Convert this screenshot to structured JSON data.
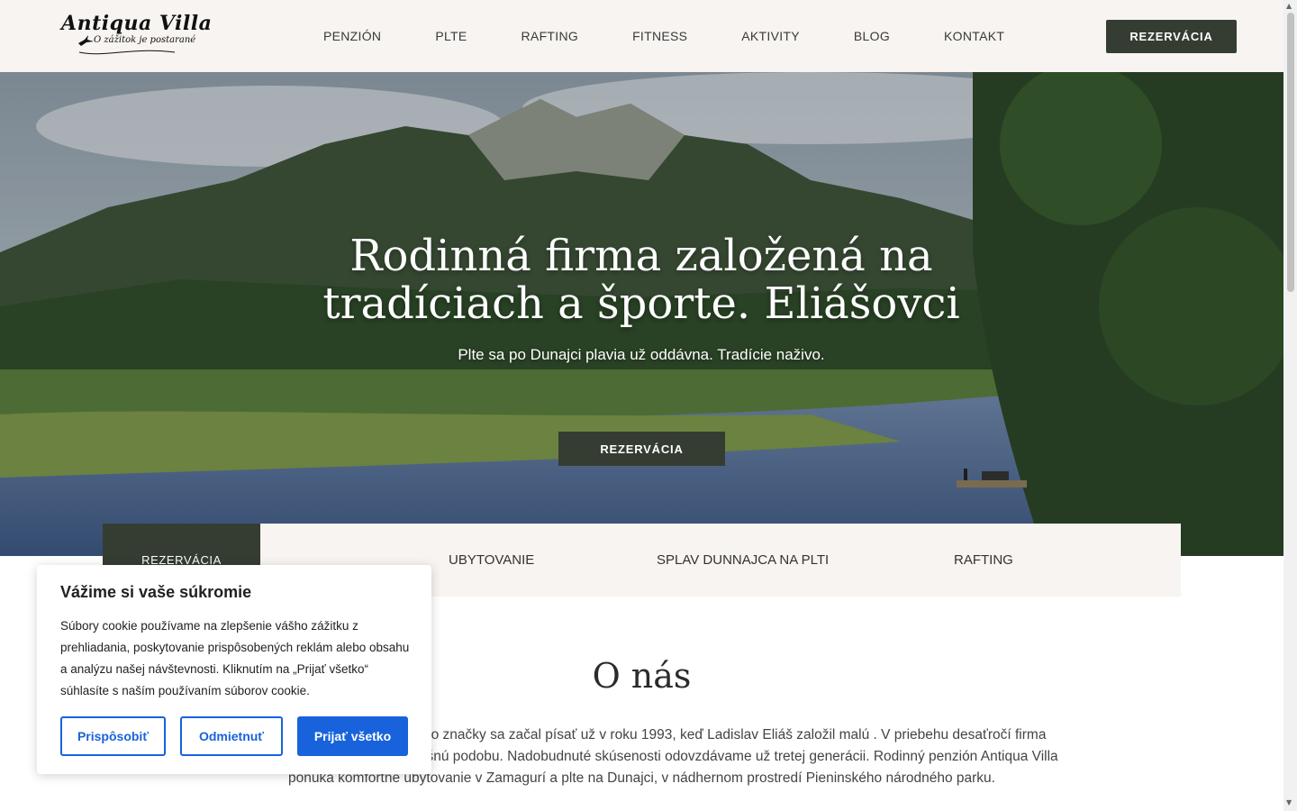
{
  "header": {
    "logo_title": "Antiqua Villa",
    "logo_tagline": "O zážitok je postarané",
    "nav": [
      "PENZIÓN",
      "PLTE",
      "RAFTING",
      "FITNESS",
      "AKTIVITY",
      "BLOG",
      "KONTAKT"
    ],
    "cta": "REZERVÁCIA"
  },
  "hero": {
    "title": "Rodinná firma založená na tradíciach a športe. Eliášovci",
    "subtitle": "Plte sa po Dunajci plavia už oddávna. Tradície naživo.",
    "cta": "REZERVÁCIA"
  },
  "tabs": {
    "active": "REZERVÁCIA",
    "items": [
      "UBYTOVANIE",
      "SPLAV DUNNAJCA NA PLTI",
      "RAFTING"
    ]
  },
  "about": {
    "title": "O nás",
    "text": "firmy – Antiqua Villa. Príbeh tejto značky sa začal písať už v roku 1993, keď Ladislav Eliáš založil malú . V priebehu desaťročí firma postupne rástla, až dosiahla dnešnú podobu. Nadobudnuté skúsenosti odovzdávame už tretej generácii. Rodinný penzión Antiqua Villa ponúka komfortné ubytovanie v Zamagurí a plte na Dunajci, v nádhernom prostredí Pieninského národného parku."
  },
  "cookie": {
    "title": "Vážime si vaše súkromie",
    "text": "Súbory cookie používame na zlepšenie vášho zážitku z prehliadania, poskytovanie prispôsobených reklám alebo obsahu a analýzu našej návštevnosti. Kliknutím na „Prijať všetko“ súhlasíte s naším používaním súborov cookie.",
    "btn_customize": "Prispôsobiť",
    "btn_reject": "Odmietnuť",
    "btn_accept": "Prijať všetko"
  },
  "colors": {
    "header_bg": "#f7f4f1",
    "accent_dark": "#353d33",
    "cookie_blue": "#1863dc"
  }
}
